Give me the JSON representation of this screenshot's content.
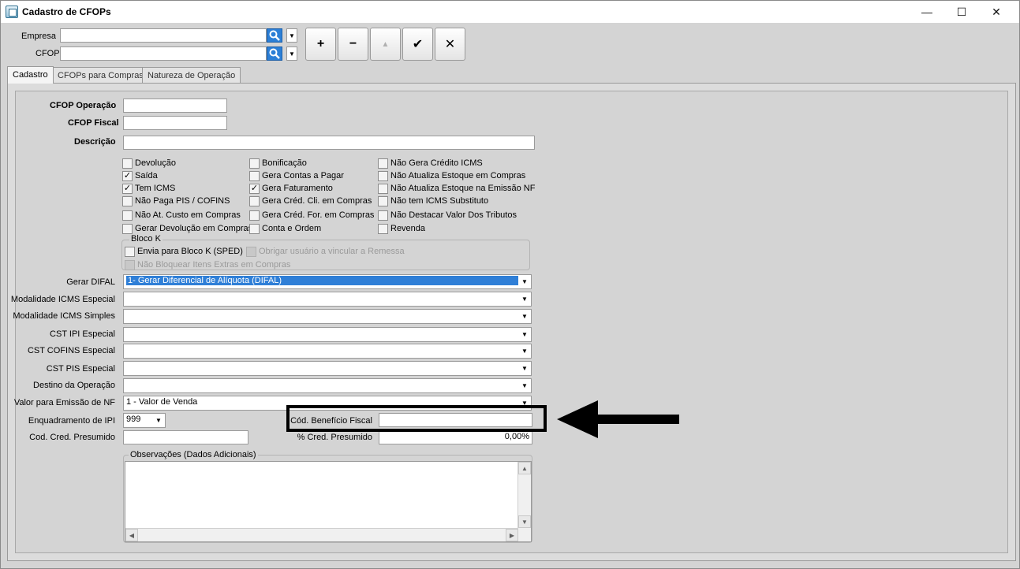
{
  "window": {
    "title": "Cadastro de CFOPs",
    "controls": {
      "minimize": "—",
      "maximize": "☐",
      "close": "✕"
    }
  },
  "filters": {
    "empresa_label": "Empresa",
    "empresa_value": "",
    "cfop_label": "CFOP",
    "cfop_value": ""
  },
  "toolbar": {
    "add": "+",
    "remove": "−",
    "up": "▲",
    "confirm": "✔",
    "cancel": "✕"
  },
  "tabs": [
    {
      "label": "Cadastro",
      "active": true
    },
    {
      "label": "CFOPs para Compras",
      "active": false
    },
    {
      "label": "Natureza de Operação",
      "active": false
    }
  ],
  "form": {
    "cfop_operacao_label": "CFOP Operação",
    "cfop_operacao_value": "",
    "cfop_fiscal_label": "CFOP Fiscal",
    "cfop_fiscal_value": "",
    "descricao_label": "Descrição",
    "descricao_value": "",
    "checkboxes": {
      "col1": [
        {
          "label": "Devolução",
          "checked": false
        },
        {
          "label": "Saída",
          "checked": true
        },
        {
          "label": "Tem ICMS",
          "checked": true
        },
        {
          "label": "Não Paga PIS / COFINS",
          "checked": false
        },
        {
          "label": "Não At. Custo em Compras",
          "checked": false
        },
        {
          "label": "Gerar Devolução em Compras",
          "checked": false
        }
      ],
      "col2": [
        {
          "label": "Bonificação",
          "checked": false
        },
        {
          "label": "Gera Contas a Pagar",
          "checked": false
        },
        {
          "label": "Gera Faturamento",
          "checked": true
        },
        {
          "label": "Gera Créd. Cli. em Compras",
          "checked": false
        },
        {
          "label": "Gera Créd. For. em Compras",
          "checked": false
        },
        {
          "label": "Conta e Ordem",
          "checked": false
        }
      ],
      "col3": [
        {
          "label": "Não Gera Crédito ICMS",
          "checked": false
        },
        {
          "label": "Não Atualiza Estoque em Compras",
          "checked": false
        },
        {
          "label": "Não Atualiza Estoque na Emissão NF",
          "checked": false
        },
        {
          "label": "Não tem ICMS Substituto",
          "checked": false
        },
        {
          "label": "Não Destacar Valor Dos Tributos",
          "checked": false
        },
        {
          "label": "Revenda",
          "checked": false
        }
      ]
    },
    "bloco_k": {
      "title": "Bloco K",
      "envia": "Envia para Bloco K (SPED)",
      "obrigar": "Obrigar usuário a vincular a Remessa",
      "nao_bloquear": "Não Bloquear Itens Extras em Compras"
    },
    "gerar_difal_label": "Gerar DIFAL",
    "gerar_difal_value": "1- Gerar Diferencial de Alíquota (DIFAL)",
    "modalidade_icms_especial_label": "Modalidade ICMS Especial",
    "modalidade_icms_especial_value": "",
    "modalidade_icms_simples_label": "Modalidade ICMS Simples",
    "modalidade_icms_simples_value": "",
    "cst_ipi_especial_label": "CST IPI Especial",
    "cst_ipi_especial_value": "",
    "cst_cofins_especial_label": "CST COFINS Especial",
    "cst_cofins_especial_value": "",
    "cst_pis_especial_label": "CST PIS Especial",
    "cst_pis_especial_value": "",
    "destino_operacao_label": "Destino da Operação",
    "destino_operacao_value": "",
    "valor_emissao_label": "Valor para Emissão de NF",
    "valor_emissao_value": "1 - Valor de Venda",
    "enquadramento_ipi_label": "Enquadramento de IPI",
    "enquadramento_ipi_value": "999",
    "cod_beneficio_label": "Cód. Benefício Fiscal",
    "cod_beneficio_value": "",
    "cod_cred_presumido_label": "Cod. Cred. Presumido",
    "cod_cred_presumido_value": "",
    "perc_cred_presumido_label": "% Cred. Presumido",
    "perc_cred_presumido_value": "0,00%",
    "observacoes_label": "Observações (Dados Adicionais)",
    "observacoes_value": ""
  },
  "colors": {
    "selection": "#2f7fd7",
    "search_button": "#2c7fd6",
    "annotation": "#000000"
  }
}
